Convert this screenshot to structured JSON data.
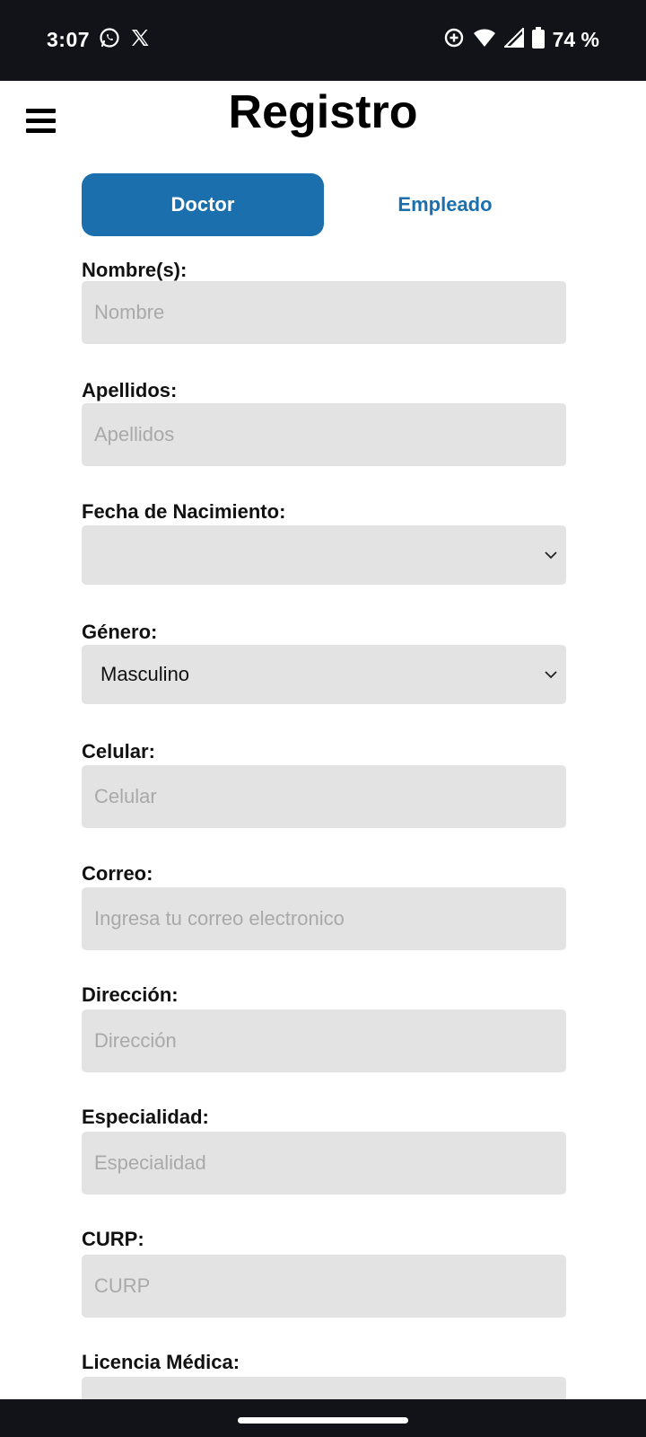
{
  "status_bar": {
    "time": "3:07",
    "battery": "74 %",
    "icons": [
      "whatsapp-icon",
      "x-icon",
      "data-saver-icon",
      "wifi-icon",
      "signal-icon",
      "battery-icon"
    ]
  },
  "header": {
    "title": "Registro",
    "menu_icon": "hamburger-menu-icon"
  },
  "tabs": [
    {
      "label": "Doctor",
      "active": true
    },
    {
      "label": "Empleado",
      "active": false
    }
  ],
  "form": {
    "nombre": {
      "label": "Nombre(s):",
      "placeholder": "Nombre"
    },
    "apellidos": {
      "label": "Apellidos:",
      "placeholder": "Apellidos"
    },
    "fecha": {
      "label": "Fecha de Nacimiento:",
      "value": ""
    },
    "genero": {
      "label": "Género:",
      "value": "Masculino"
    },
    "celular": {
      "label": "Celular:",
      "placeholder": "Celular"
    },
    "correo": {
      "label": "Correo:",
      "placeholder": "Ingresa tu correo electronico"
    },
    "direccion": {
      "label": "Dirección:",
      "placeholder": "Dirección"
    },
    "especialidad": {
      "label": "Especialidad:",
      "placeholder": "Especialidad"
    },
    "curp": {
      "label": "CURP:",
      "placeholder": "CURP"
    },
    "licencia": {
      "label": "Licencia Médica:",
      "placeholder": ""
    }
  },
  "colors": {
    "accent": "#1c6fad",
    "field_bg": "#e3e3e3",
    "system_bar": "#121318"
  }
}
